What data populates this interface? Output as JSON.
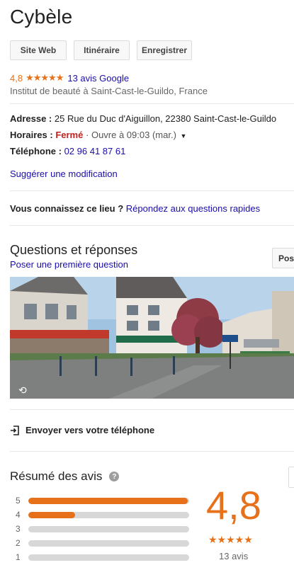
{
  "place": {
    "name": "Cybèle",
    "rating": "4,8",
    "stars": "★★★★★",
    "reviews_link": "13 avis Google",
    "category": "Institut de beauté à Saint-Cast-le-Guildo, France"
  },
  "actions": {
    "website": "Site Web",
    "directions": "Itinéraire",
    "save": "Enregistrer"
  },
  "details": {
    "address_label": "Adresse :",
    "address_value": "25 Rue du Duc d'Aiguillon, 22380 Saint-Cast-le-Guildo",
    "hours_label": "Horaires :",
    "hours_status": "Fermé",
    "hours_separator": "·",
    "hours_next": "Ouvre à 09:03 (mar.)",
    "phone_label": "Téléphone :",
    "phone_value": "02 96 41 87 61",
    "suggest_edit": "Suggérer une modification"
  },
  "know_place": {
    "question": "Vous connaissez ce lieu ?",
    "link": "Répondez aux questions rapides"
  },
  "qa": {
    "title": "Questions et réponses",
    "subtitle": "Poser une première question",
    "post_button": "Pos"
  },
  "send": {
    "label": "Envoyer vers votre téléphone"
  },
  "reviews_summary": {
    "title": "Résumé des avis",
    "help": "?",
    "score": "4,8",
    "stars": "★★★★★",
    "count": "13 avis"
  },
  "chart_data": {
    "type": "bar",
    "categories": [
      "5",
      "4",
      "3",
      "2",
      "1"
    ],
    "values": [
      0.99,
      0.29,
      0,
      0,
      0
    ],
    "title": "",
    "xlabel": "",
    "ylabel": ""
  },
  "colors": {
    "accent": "#e7711b",
    "link": "#1a0dab",
    "closed": "#c5221f"
  }
}
